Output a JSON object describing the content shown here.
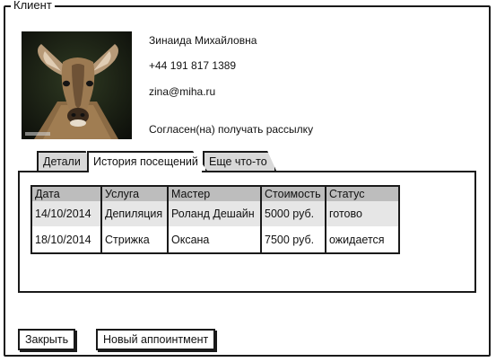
{
  "window": {
    "title": "Клиент"
  },
  "client": {
    "name": "Зинаида Михайловна",
    "phone": "+44 191 817 1389",
    "email": "zina@miha.ru",
    "newsletter": "Согласен(на) получать рассылку"
  },
  "tabs": [
    {
      "label": "Детали",
      "active": false
    },
    {
      "label": "История посещений",
      "active": true
    },
    {
      "label": "Еще что-то",
      "active": false
    }
  ],
  "history": {
    "columns": [
      "Дата",
      "Услуга",
      "Мастер",
      "Стоимость",
      "Статус"
    ],
    "rows": [
      [
        "14/10/2014",
        "Депиляция",
        "Роланд Дешайн",
        "5000 руб.",
        "готово"
      ],
      [
        "18/10/2014",
        "Стрижка",
        "Оксана",
        "7500 руб.",
        "ожидается"
      ]
    ]
  },
  "buttons": {
    "close": "Закрыть",
    "new_appointment": "Новый аппоинтмент"
  }
}
